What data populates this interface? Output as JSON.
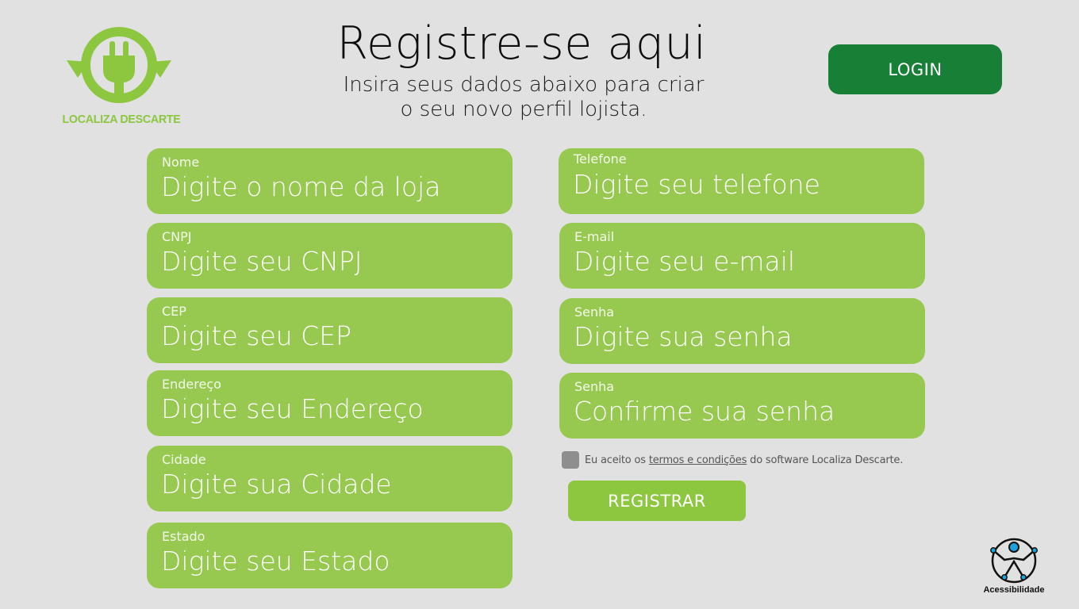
{
  "brand": {
    "name": "LOCALIZA DESCARTE",
    "color": "#8dc63f",
    "icon": "recycle-plug-icon"
  },
  "header": {
    "title": "Registre-se aqui",
    "subtitle_line1": "Insira seus dados abaixo para criar",
    "subtitle_line2": "o seu novo perfil  lojista."
  },
  "login": {
    "label": "LOGIN",
    "color": "#187f37"
  },
  "form": {
    "field_color": "#97c951",
    "left": [
      {
        "label": "Nome",
        "placeholder": "Digite o nome da loja"
      },
      {
        "label": "CNPJ",
        "placeholder": "Digite seu CNPJ"
      },
      {
        "label": "CEP",
        "placeholder": "Digite seu CEP"
      },
      {
        "label": "Endereço",
        "placeholder": "Digite seu Endereço"
      },
      {
        "label": "Cidade",
        "placeholder": "Digite sua Cidade"
      },
      {
        "label": "Estado",
        "placeholder": "Digite seu Estado"
      }
    ],
    "right": [
      {
        "label": "Telefone",
        "placeholder": "Digite seu telefone"
      },
      {
        "label": "E-mail",
        "placeholder": "Digite seu e-mail"
      },
      {
        "label": "Senha",
        "placeholder": "Digite sua senha"
      },
      {
        "label": "Senha",
        "placeholder": "Confirme sua senha"
      }
    ]
  },
  "terms": {
    "prefix": "Eu aceito os",
    "link": "termos e condições",
    "suffix": "do software Localiza Descarte.",
    "checked": false
  },
  "register": {
    "label": "REGISTRAR",
    "color": "#8dc63f"
  },
  "accessibility": {
    "label": "Acessibilidade",
    "icon": "accessibility-icon"
  }
}
